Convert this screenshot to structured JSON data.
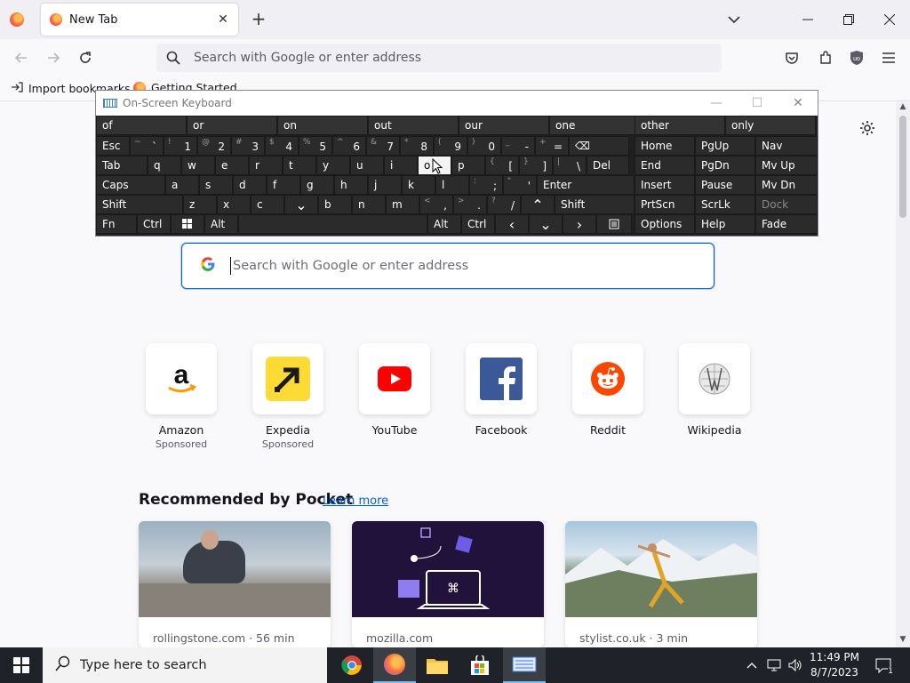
{
  "browser": {
    "tab_title": "New Tab",
    "url_placeholder": "Search with Google or enter address",
    "bookmarks": [
      "Import bookmarks...",
      "Getting Started"
    ]
  },
  "keyboard": {
    "title": "On-Screen Keyboard",
    "predictions": [
      "of",
      "or",
      "on",
      "out",
      "our",
      "one",
      "other",
      "only"
    ],
    "rows": [
      [
        {
          "m": "Esc"
        },
        {
          "s": "~",
          "m": "`"
        },
        {
          "s": "!",
          "m": "1"
        },
        {
          "s": "@",
          "m": "2"
        },
        {
          "s": "#",
          "m": "3"
        },
        {
          "s": "$",
          "m": "4"
        },
        {
          "s": "%",
          "m": "5"
        },
        {
          "s": "^",
          "m": "6"
        },
        {
          "s": "&",
          "m": "7"
        },
        {
          "s": "*",
          "m": "8"
        },
        {
          "s": "(",
          "m": "9"
        },
        {
          "s": ")",
          "m": "0"
        },
        {
          "s": "_",
          "m": "-"
        },
        {
          "s": "+",
          "m": "="
        },
        {
          "m": "⌫"
        }
      ],
      [
        {
          "m": "Tab"
        },
        {
          "m": "q"
        },
        {
          "m": "w"
        },
        {
          "m": "e"
        },
        {
          "m": "r"
        },
        {
          "m": "t"
        },
        {
          "m": "y"
        },
        {
          "m": "u"
        },
        {
          "m": "i"
        },
        {
          "m": "o"
        },
        {
          "m": "p"
        },
        {
          "s": "{",
          "m": "["
        },
        {
          "s": "}",
          "m": "]"
        },
        {
          "s": "|",
          "m": "\\"
        },
        {
          "m": "Del"
        }
      ],
      [
        {
          "m": "Caps"
        },
        {
          "m": "a"
        },
        {
          "m": "s"
        },
        {
          "m": "d"
        },
        {
          "m": "f"
        },
        {
          "m": "g"
        },
        {
          "m": "h"
        },
        {
          "m": "j"
        },
        {
          "m": "k"
        },
        {
          "m": "l"
        },
        {
          "s": ":",
          "m": ";"
        },
        {
          "s": "\"",
          "m": "'"
        },
        {
          "m": "Enter"
        }
      ],
      [
        {
          "m": "Shift"
        },
        {
          "m": "z"
        },
        {
          "m": "x"
        },
        {
          "m": "c"
        },
        {
          "m": "v"
        },
        {
          "m": "b"
        },
        {
          "m": "n"
        },
        {
          "m": "m"
        },
        {
          "s": "<",
          "m": ","
        },
        {
          "s": ">",
          "m": "."
        },
        {
          "s": "?",
          "m": "/"
        },
        {
          "m": "^"
        },
        {
          "m": "Shift"
        }
      ],
      [
        {
          "m": "Fn"
        },
        {
          "m": "Ctrl"
        },
        {
          "m": "win"
        },
        {
          "m": "Alt"
        },
        {
          "m": ""
        },
        {
          "m": "Alt"
        },
        {
          "m": "Ctrl"
        },
        {
          "m": "<"
        },
        {
          "m": "v"
        },
        {
          "m": ">"
        },
        {
          "m": "menu"
        }
      ]
    ],
    "nav": [
      [
        "Home",
        "PgUp",
        "Nav"
      ],
      [
        "End",
        "PgDn",
        "Mv Up"
      ],
      [
        "Insert",
        "Pause",
        "Mv Dn"
      ],
      [
        "PrtScn",
        "ScrLk",
        "Dock"
      ],
      [
        "Options",
        "Help",
        "Fade"
      ]
    ]
  },
  "newtab": {
    "search_placeholder": "Search with Google or enter address",
    "shortcuts": [
      {
        "name": "Amazon",
        "sponsor": "Sponsored"
      },
      {
        "name": "Expedia",
        "sponsor": "Sponsored"
      },
      {
        "name": "YouTube",
        "sponsor": ""
      },
      {
        "name": "Facebook",
        "sponsor": ""
      },
      {
        "name": "Reddit",
        "sponsor": ""
      },
      {
        "name": "Wikipedia",
        "sponsor": ""
      }
    ],
    "pocket_title": "Recommended by Pocket",
    "pocket_learn": "Learn more",
    "cards": [
      {
        "source": "rollingstone.com · 56 min"
      },
      {
        "source": "mozilla.com"
      },
      {
        "source": "stylist.co.uk · 3 min"
      }
    ]
  },
  "taskbar": {
    "search_placeholder": "Type here to search",
    "time": "11:49 PM",
    "date": "8/7/2023",
    "notif_count": "1"
  }
}
